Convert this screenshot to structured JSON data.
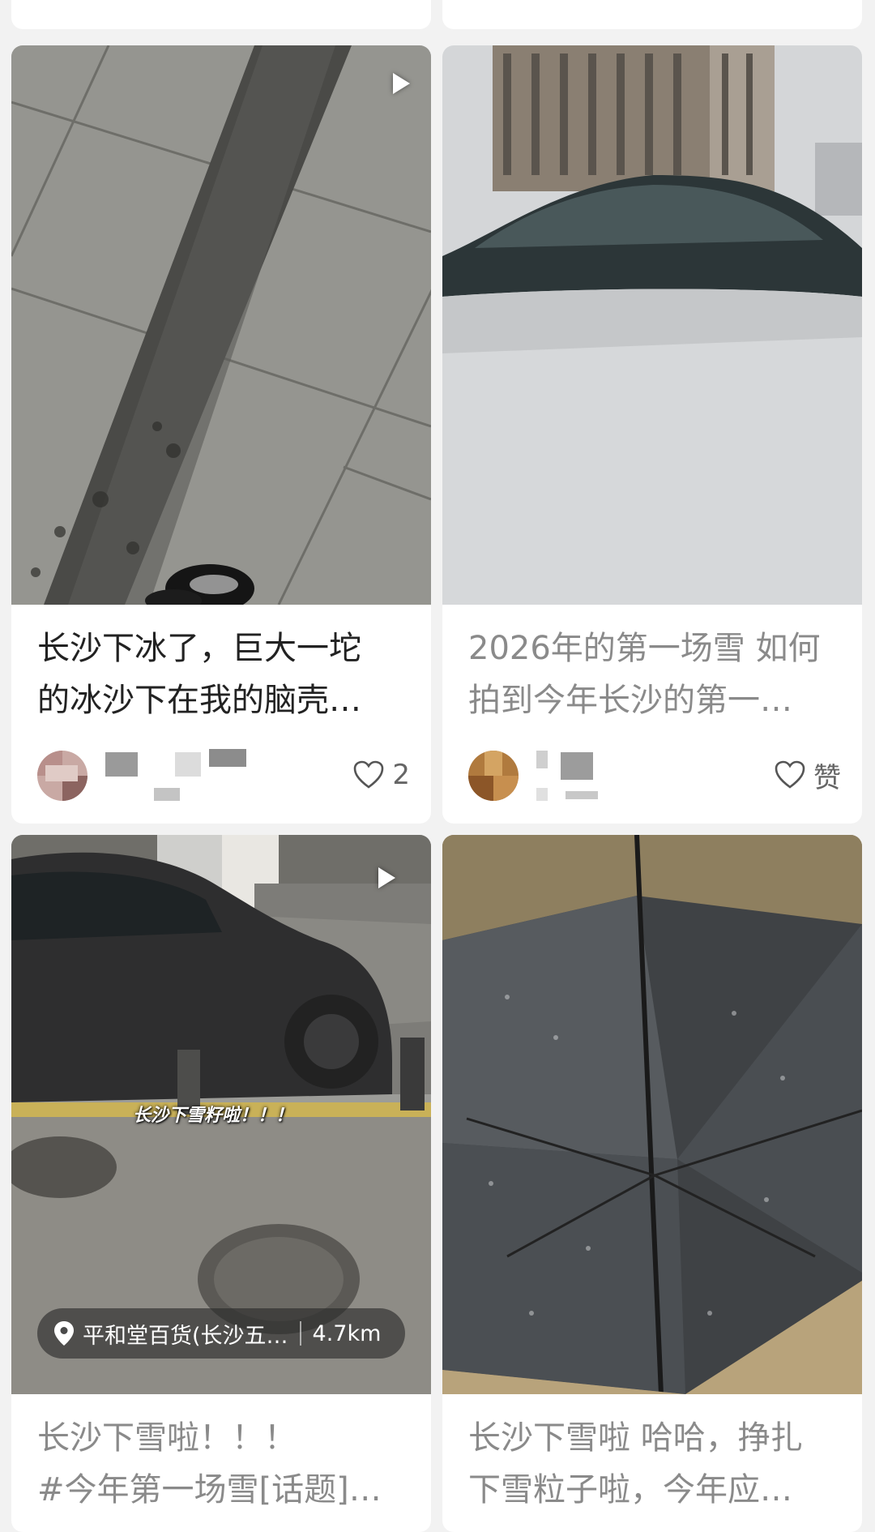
{
  "feed": {
    "cards": [
      {
        "title_line1": "长沙下冰了，巨大一坨",
        "title_line2": "的冰沙下在我的脑壳…",
        "likes": "2",
        "has_video": true
      },
      {
        "title_line1": "2026年的第一场雪 如何",
        "title_line2": "拍到今年长沙的第一…",
        "likes": "赞",
        "has_video": false
      },
      {
        "title_line1": "长沙下雪啦！！！",
        "title_line2": "#今年第一场雪[话题]…",
        "has_video": true,
        "overlay_caption": "长沙下雪籽啦！！！",
        "location": {
          "place": "平和堂百货(长沙五…",
          "distance": "4.7km"
        }
      },
      {
        "title_line1": "长沙下雪啦 哈哈，挣扎",
        "title_line2": "下雪粒子啦，今年应…",
        "has_video": false
      }
    ]
  },
  "icons": {
    "play": "play-icon",
    "like": "heart-outline-icon",
    "location": "location-pin-icon"
  },
  "colors": {
    "background": "#f2f2f2",
    "card": "#ffffff",
    "title_text": "#222222",
    "title_text_secondary": "#8a8a8a"
  }
}
